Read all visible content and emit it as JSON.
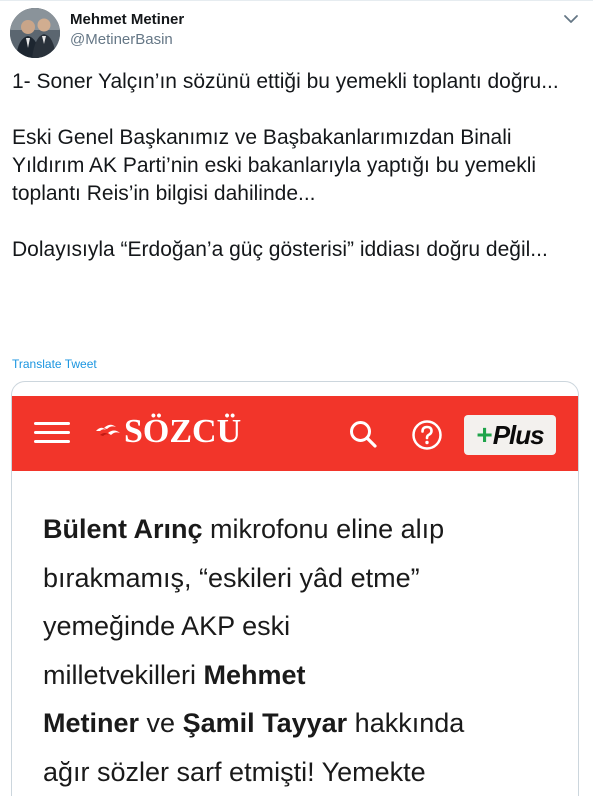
{
  "tweet": {
    "author": {
      "name": "Mehmet Metiner",
      "handle": "@MetinerBasin"
    },
    "paragraphs": [
      "1- Soner Yalçın’ın sözünü ettiği bu yemekli toplantı doğru...",
      "Eski Genel Başkanımız ve Başbakanlarımızdan Binali Yıldırım AK Parti’nin eski bakanlarıyla yaptığı bu yemekli toplantı Reis’in bilgisi dahilinde...",
      "Dolayısıyla “Erdoğan’a güç gösterisi” iddiası doğru değil..."
    ],
    "translate_label": "Translate Tweet",
    "icons": {
      "options": "chevron-down-icon"
    }
  },
  "media": {
    "header": {
      "background_color": "#f2352a",
      "logo_text": "SÖZCÜ",
      "plus_sign": "+",
      "plus_label": "Plus",
      "plus_sign_color": "#1fa34a",
      "icons": {
        "menu": "hamburger-menu-icon",
        "search": "search-icon",
        "help": "help-circle-icon",
        "logo": "birds-logo-icon"
      }
    },
    "article": {
      "line1_bold": "Bülent Arınç",
      "line1_rest": " mikrofonu eline alıp",
      "line2": "bırakmamış, “eskileri yâd etme”",
      "line3": "yemeğinde AKP eski",
      "line4_plain": "milletvekilleri ",
      "line4_bold": "Mehmet",
      "line5_bold1": "Metiner",
      "line5_mid": " ve ",
      "line5_bold2": "Şamil Tayyar",
      "line5_rest": " hakkında",
      "line6": "ağır sözler sarf etmişti! Yemekte"
    }
  }
}
